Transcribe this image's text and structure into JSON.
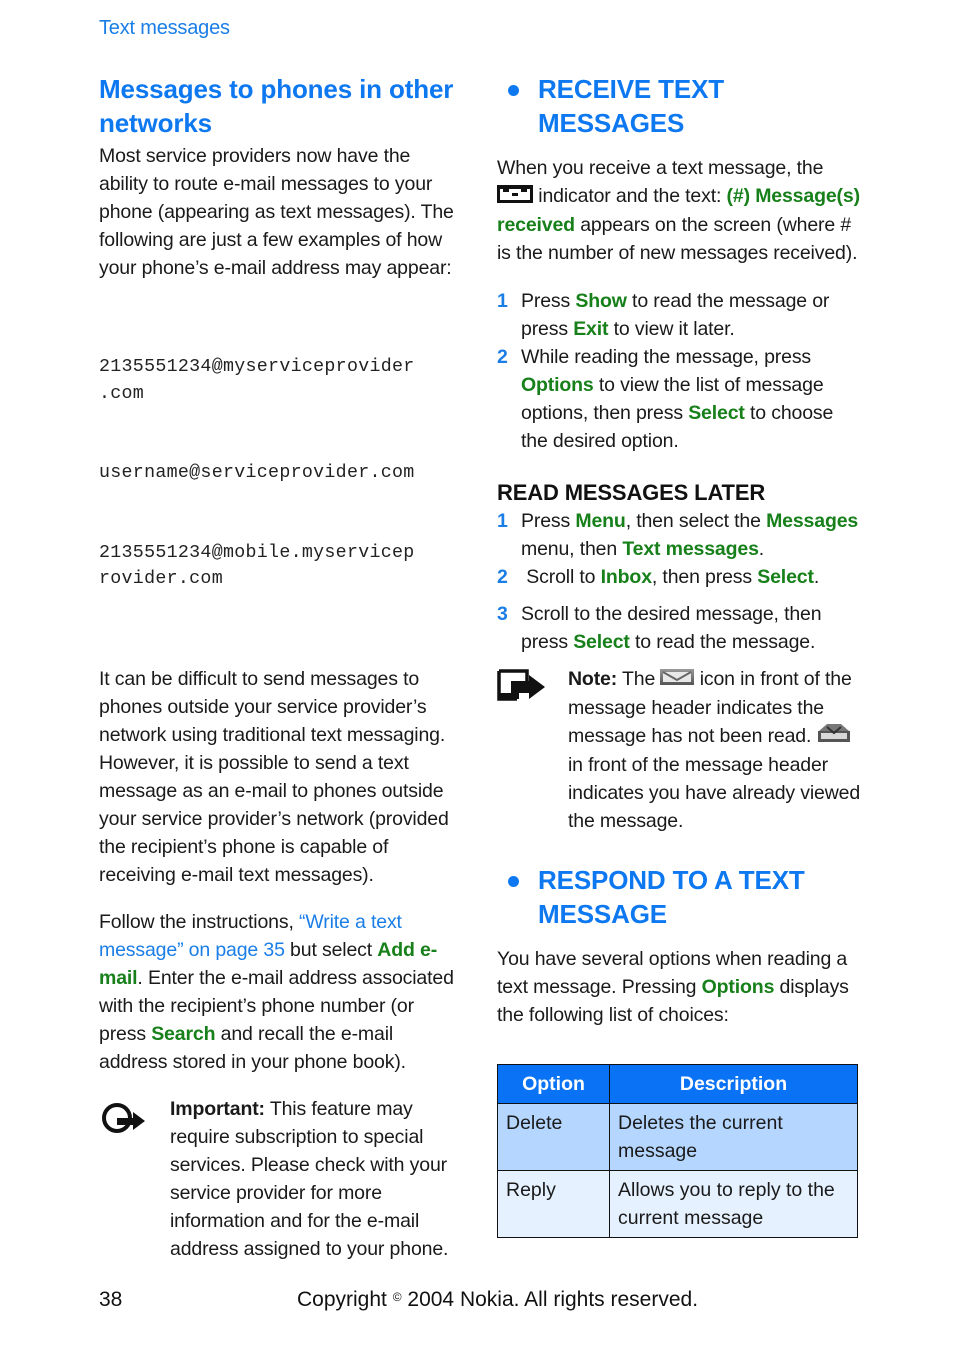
{
  "running_head": "Text messages",
  "left": {
    "heading": "Messages to phones in other networks",
    "intro": "Most service providers now have the ability to route e-mail messages to your phone (appearing as text messages). The following are just a few examples of how your phone’s e-mail address may appear:",
    "email_examples": [
      "2135551234@myserviceprovider\n.com",
      "username@serviceprovider.com",
      "2135551234@mobile.myservicep\nrovider.com"
    ],
    "para2": "It can be difficult to send messages to phones outside your service provider’s network using traditional text messaging. However, it is possible to send a text message as an e-mail to phones outside your service provider’s network (provided the recipient’s phone is capable of receiving e-mail text messages).",
    "para3": {
      "t1": "Follow the instructions, ",
      "link": "“Write a text message” on page 35",
      "t2": " but select ",
      "k1": "Add e-mail",
      "t3": ". Enter the e-mail address associated with the recipient’s phone number (or press ",
      "k2": "Search",
      "t4": " and recall the e-mail address stored in your phone book)."
    },
    "important": {
      "label": "Important:",
      "text": " This feature may require subscription to special services. Please check with your service provider for more information and for the e-mail address assigned to your phone."
    }
  },
  "right": {
    "receive": {
      "heading": "RECEIVE TEXT MESSAGES",
      "p": {
        "t1": "When you receive a text message, the ",
        "t2": " indicator and the text: ",
        "k1": "(#) Message(s) received",
        "t3": " appears on the screen (where # is the number of new messages received)."
      },
      "steps": [
        {
          "num": "1",
          "t1": "Press ",
          "k1": "Show",
          "t2": " to read the message or press ",
          "k2": "Exit",
          "t3": " to view it later."
        },
        {
          "num": "2",
          "t1": "While reading the message, press ",
          "k1": "Options",
          "t2": " to view the list of message options, then press ",
          "k2": "Select",
          "t3": " to choose the desired option."
        }
      ]
    },
    "read_later": {
      "heading": "READ MESSAGES LATER",
      "steps": [
        {
          "num": "1",
          "t1": "Press ",
          "k1": "Menu",
          "t2": ", then select the ",
          "k2": "Messages",
          "t3": " menu, then ",
          "k3": "Text messages",
          "t4": "."
        },
        {
          "num": "2",
          "t1": " Scroll to ",
          "k1": "Inbox",
          "t2": ", then press ",
          "k2": "Select",
          "t3": "."
        },
        {
          "num": "3",
          "t1": "Scroll to the desired message, then press ",
          "k1": "Select",
          "t2": " to read the message."
        }
      ],
      "note": {
        "label": "Note:",
        "t1": " The ",
        "t2": " icon in front of the message header indicates the message has not been read. ",
        "t3": " in front of the message header indicates you have already viewed the message."
      }
    },
    "respond": {
      "heading": "RESPOND TO A TEXT MESSAGE",
      "p": {
        "t1": "You have several options when reading a text message. Pressing ",
        "k1": "Options",
        "t2": " displays the following list of choices:"
      },
      "table": {
        "headers": [
          "Option",
          "Description"
        ],
        "rows": [
          [
            "Delete",
            "Deletes the current message"
          ],
          [
            "Reply",
            "Allows you to reply to the current message"
          ]
        ]
      }
    }
  },
  "footer": {
    "page_number": "38",
    "copyright_pre": "Copyright ",
    "copyright_symbol": "©",
    "copyright_post": " 2004 Nokia. All rights reserved."
  },
  "colors": {
    "heading_blue": "#0d78f0",
    "key_green": "#17801a",
    "table_header": "#0a73f5",
    "table_row1": "#b5d6ff",
    "table_row2": "#e6f1ff"
  }
}
